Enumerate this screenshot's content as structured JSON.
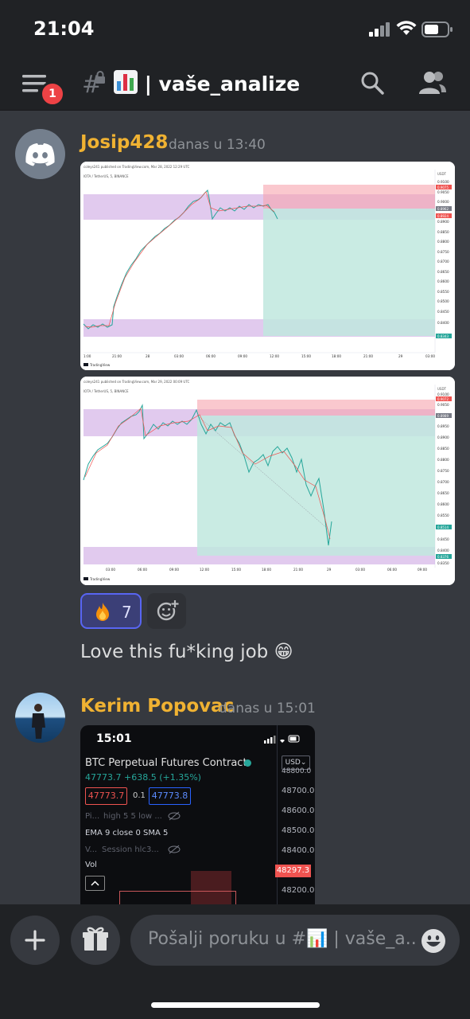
{
  "status_bar": {
    "time": "21:04"
  },
  "header": {
    "notification_count": "1",
    "channel_name": "| vaše_analize",
    "channel_emoji": "bar-chart-emoji"
  },
  "messages": [
    {
      "author": "Josip428",
      "timestamp": "danas u 13:40",
      "author_color": "#f0b232",
      "avatar": "discord-logo",
      "images": [
        {
          "kind": "tradingview-chart",
          "caption": "coleys241 published on TradingView.com, Mar 28, 2022 12:29 UTC",
          "symbol": "IOTA / TetherUS, 5, BINANCE",
          "currency": "USDT",
          "price_labels": [
            "0.9100",
            "0.9050",
            "0.9000",
            "0.8950",
            "0.8900",
            "0.8850",
            "0.8800",
            "0.8750",
            "0.8700",
            "0.8650",
            "0.8600",
            "0.8550",
            "0.8500",
            "0.8450",
            "0.8400"
          ],
          "tags": [
            "0.9075",
            "0.8962",
            "0.8924",
            "0.8343"
          ],
          "time_labels": [
            "1:00",
            "21:00",
            "28",
            "03:00",
            "06:00",
            "09:00",
            "12:00",
            "15:00",
            "18:00",
            "21:00",
            "29",
            "03:00"
          ],
          "brand": "TradingView"
        },
        {
          "kind": "tradingview-chart",
          "caption": "coleys241 published on TradingView.com, Mar 29, 2022 00:09 UTC",
          "symbol": "IOTA / TetherUS, 5, BINANCE",
          "currency": "USDT",
          "price_labels": [
            "0.9100",
            "0.9050",
            "0.9000",
            "0.8950",
            "0.8900",
            "0.8850",
            "0.8800",
            "0.8750",
            "0.8700",
            "0.8650",
            "0.8600",
            "0.8550",
            "0.8500",
            "0.8450",
            "0.8400",
            "0.8350"
          ],
          "tags": [
            "0.9072",
            "0.8989",
            "0.8514",
            "0.8376"
          ],
          "time_labels": [
            "03:00",
            "06:00",
            "09:00",
            "12:00",
            "15:00",
            "18:00",
            "21:00",
            "29",
            "03:00",
            "06:00",
            "09:00"
          ],
          "brand": "TradingView"
        }
      ],
      "reaction": {
        "emoji": "fire",
        "count": "7"
      },
      "text": "Love this fu*king job 😁"
    },
    {
      "author": "Kerim Popovac",
      "timestamp": "danas u 15:01",
      "author_color": "#f0b232",
      "avatar": "photo-person-by-sea",
      "screenshot": {
        "time": "15:01",
        "title": "BTC Perpetual Futures Contract",
        "price_line": "47773.7 +638.5 (+1.35%)",
        "bid": "47773.7",
        "spread": "0.1",
        "ask": "47773.8",
        "currency": "USD",
        "row_pi": "Pi...",
        "row_pi_values": "high 5 5 low ...",
        "ema_line": "EMA 9 close 0 SMA 5",
        "row_v": "V...",
        "row_v_values": "Session hlc3...",
        "vol_label": "Vol",
        "price_axis": [
          "48800.0",
          "48700.0",
          "48600.0",
          "48500.0",
          "48400.0",
          "48200.0"
        ],
        "current_price_tag": "48297.3"
      }
    }
  ],
  "composer": {
    "placeholder": "Pošalji poruku u #📊 | vaše_a.."
  }
}
